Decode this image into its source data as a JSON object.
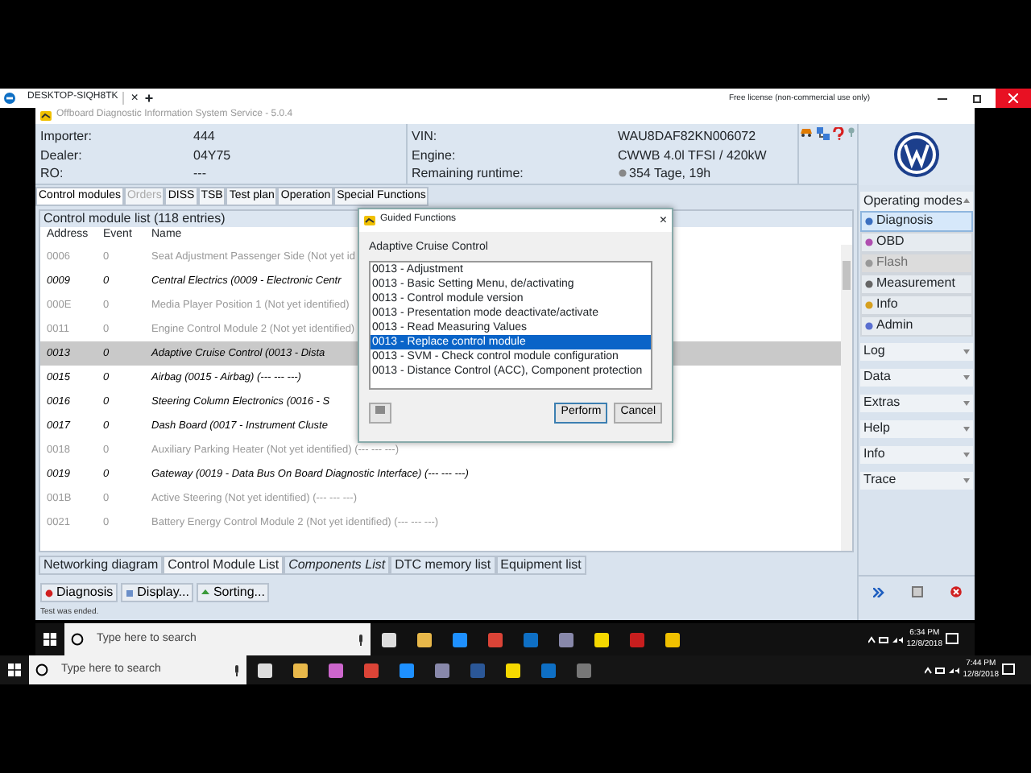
{
  "remote_tab": {
    "title": "DESKTOP-SIQH8TK",
    "close": "×",
    "add": "+",
    "license": "Free license (non-commercial use only)"
  },
  "window": {
    "title": "Offboard Diagnostic Information System Service - 5.0.4"
  },
  "vehicle_info": [
    {
      "label": "Importer:",
      "value": "444"
    },
    {
      "label": "Dealer:",
      "value": "04Y75"
    },
    {
      "label": "RO:",
      "value": "---"
    }
  ],
  "vehicle_info_2": [
    {
      "label": "VIN:",
      "value": "WAU8DAF82KN006072"
    },
    {
      "label": "Engine:",
      "value": "CWWB 4.0l TFSI / 420kW"
    },
    {
      "label": "Remaining runtime:",
      "value": "354 Tage, 19h"
    }
  ],
  "tabs": [
    {
      "label": "Control modules",
      "selected": true,
      "disabled": false
    },
    {
      "label": "Orders",
      "selected": false,
      "disabled": true
    },
    {
      "label": "DISS",
      "selected": false,
      "disabled": false
    },
    {
      "label": "TSB",
      "selected": false,
      "disabled": false
    },
    {
      "label": "Test plan",
      "selected": false,
      "disabled": false
    },
    {
      "label": "Operation",
      "selected": false,
      "disabled": false
    },
    {
      "label": "Special Functions",
      "selected": false,
      "disabled": false
    }
  ],
  "module_list": {
    "title": "Control module list (118 entries)",
    "columns": [
      "Address",
      "Event",
      "Name"
    ],
    "rows": [
      {
        "address": "0006",
        "event": "0",
        "name": "Seat Adjustment Passenger Side (Not yet id",
        "identified": false,
        "selected": false
      },
      {
        "address": "0009",
        "event": "0",
        "name": "Central Electrics (0009 - Electronic Centr",
        "identified": true,
        "selected": false
      },
      {
        "address": "000E",
        "event": "0",
        "name": "Media Player Position 1 (Not yet identified)",
        "identified": false,
        "selected": false
      },
      {
        "address": "0011",
        "event": "0",
        "name": "Engine Control Module 2 (Not yet identified)",
        "identified": false,
        "selected": false
      },
      {
        "address": "0013",
        "event": "0",
        "name": "Adaptive Cruise Control (0013 - Dista",
        "identified": true,
        "selected": true
      },
      {
        "address": "0015",
        "event": "0",
        "name": "Airbag (0015 - Airbag) (---  ---  ---)",
        "identified": true,
        "selected": false
      },
      {
        "address": "0016",
        "event": "0",
        "name": "Steering Column Electronics (0016 - S",
        "identified": true,
        "selected": false
      },
      {
        "address": "0017",
        "event": "0",
        "name": "Dash Board (0017 - Instrument Cluste",
        "identified": true,
        "selected": false
      },
      {
        "address": "0018",
        "event": "0",
        "name": "Auxiliary Parking Heater (Not yet identified) (---  ---  ---)",
        "identified": false,
        "selected": false
      },
      {
        "address": "0019",
        "event": "0",
        "name": "Gateway (0019 - Data Bus On Board Diagnostic Interface) (---  ---  ---)",
        "identified": true,
        "selected": false
      },
      {
        "address": "001B",
        "event": "0",
        "name": "Active Steering (Not yet identified) (---  ---  ---)",
        "identified": false,
        "selected": false
      },
      {
        "address": "0021",
        "event": "0",
        "name": "Battery Energy Control Module 2 (Not yet identified) (---  ---  ---)",
        "identified": false,
        "selected": false
      }
    ]
  },
  "bottom_tabs": [
    {
      "label": "Networking diagram",
      "selected": false,
      "italic": false
    },
    {
      "label": "Control Module List",
      "selected": true,
      "italic": false
    },
    {
      "label": "Components List",
      "selected": false,
      "italic": true
    },
    {
      "label": "DTC memory list",
      "selected": false,
      "italic": false
    },
    {
      "label": "Equipment list",
      "selected": false,
      "italic": false
    }
  ],
  "action_buttons": [
    "Diagnosis",
    "Display...",
    "Sorting..."
  ],
  "status_bar": "Test was ended.",
  "sidebar": {
    "title": "Operating modes",
    "items": [
      {
        "label": "Diagnosis",
        "selected": true,
        "disabled": false
      },
      {
        "label": "OBD",
        "selected": false,
        "disabled": false
      },
      {
        "label": "Flash",
        "selected": false,
        "disabled": true
      },
      {
        "label": "Measurement",
        "selected": false,
        "disabled": false
      },
      {
        "label": "Info",
        "selected": false,
        "disabled": false
      },
      {
        "label": "Admin",
        "selected": false,
        "disabled": false
      }
    ],
    "sections": [
      "Log",
      "Data",
      "Extras",
      "Help",
      "Info",
      "Trace"
    ]
  },
  "dialog": {
    "title": "Guided Functions",
    "close": "×",
    "heading": "Adaptive Cruise Control",
    "items": [
      {
        "label": "0013 - Adjustment",
        "selected": false
      },
      {
        "label": "0013 - Basic Setting Menu, de/activating",
        "selected": false
      },
      {
        "label": "0013 - Control module version",
        "selected": false
      },
      {
        "label": "0013 - Presentation mode deactivate/activate",
        "selected": false
      },
      {
        "label": "0013 - Read Measuring Values",
        "selected": false
      },
      {
        "label": "0013 - Replace control module",
        "selected": true
      },
      {
        "label": "0013 - SVM - Check control module configuration",
        "selected": false
      },
      {
        "label": "0013 - Distance Control (ACC), Component protection",
        "selected": false
      }
    ],
    "buttons": [
      "Perform",
      "Cancel"
    ]
  },
  "taskbars": [
    {
      "placeholder": "Type here to search",
      "time": "6:34 PM",
      "date": "12/8/2018"
    },
    {
      "placeholder": "Type here to search",
      "time": "7:44 PM",
      "date": "12/8/2018"
    }
  ]
}
